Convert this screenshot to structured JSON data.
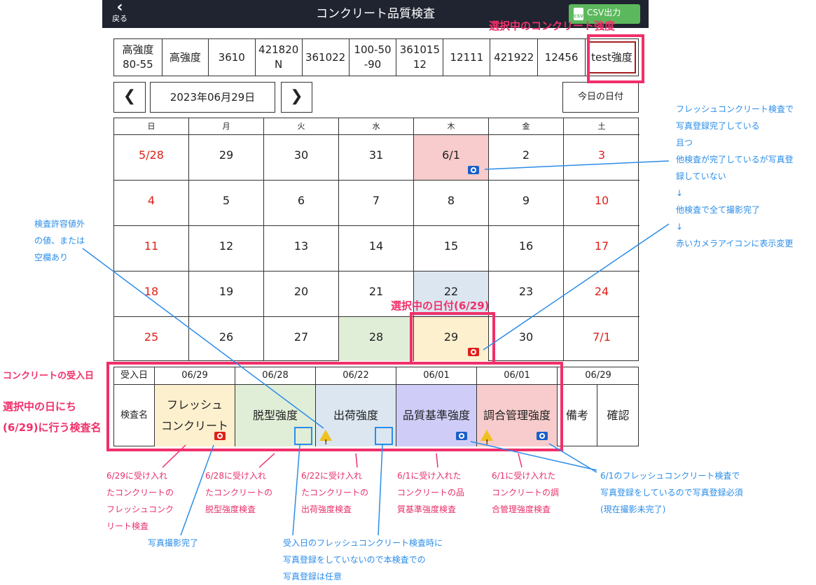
{
  "header": {
    "back_chevron": "‹",
    "back_label": "戻る",
    "title": "コンクリート品質検査",
    "csv_icon_text": "CSV",
    "csv_label": "CSV出力"
  },
  "strength_tabs": [
    {
      "label": "高強度\n80-55",
      "selected": false
    },
    {
      "label": "高強度",
      "selected": false
    },
    {
      "label": "3610",
      "selected": false
    },
    {
      "label": "421820\nN",
      "selected": false
    },
    {
      "label": "361022",
      "selected": false
    },
    {
      "label": "100-50\n-90",
      "selected": false
    },
    {
      "label": "361015\n12",
      "selected": false
    },
    {
      "label": "12111",
      "selected": false
    },
    {
      "label": "421922",
      "selected": false
    },
    {
      "label": "12456",
      "selected": false
    },
    {
      "label": "test強度",
      "selected": true
    }
  ],
  "date_nav": {
    "prev_label": "❮",
    "date": "2023年06月29日",
    "next_label": "❯",
    "today_label": "今日の日付"
  },
  "calendar": {
    "weekdays": [
      "日",
      "月",
      "火",
      "水",
      "木",
      "金",
      "土"
    ],
    "days": [
      {
        "label": "5/28",
        "red": true
      },
      {
        "label": "29"
      },
      {
        "label": "30"
      },
      {
        "label": "31"
      },
      {
        "label": "6/1",
        "bg": "#f8cccc",
        "camera": "blue-camera-icon"
      },
      {
        "label": "2"
      },
      {
        "label": "3",
        "red": true
      },
      {
        "label": "4",
        "red": true
      },
      {
        "label": "5"
      },
      {
        "label": "6"
      },
      {
        "label": "7"
      },
      {
        "label": "8"
      },
      {
        "label": "9"
      },
      {
        "label": "10",
        "red": true
      },
      {
        "label": "11",
        "red": true
      },
      {
        "label": "12"
      },
      {
        "label": "13"
      },
      {
        "label": "14"
      },
      {
        "label": "15"
      },
      {
        "label": "16"
      },
      {
        "label": "17",
        "red": true
      },
      {
        "label": "18",
        "red": true
      },
      {
        "label": "19"
      },
      {
        "label": "20"
      },
      {
        "label": "21"
      },
      {
        "label": "22",
        "bg": "#dbe6f0"
      },
      {
        "label": "23"
      },
      {
        "label": "24",
        "red": true
      },
      {
        "label": "25",
        "red": true
      },
      {
        "label": "26"
      },
      {
        "label": "27"
      },
      {
        "label": "28",
        "bg": "#e0eed8"
      },
      {
        "label": "29",
        "bg": "#fdf0cf",
        "selected": true,
        "camera": "red-camera-icon"
      },
      {
        "label": "30"
      },
      {
        "label": "7/1",
        "red": true
      }
    ]
  },
  "inspections": {
    "receipt_header": "受入日",
    "name_header": "検査名",
    "columns": [
      {
        "date": "06/29",
        "name": "フレッシュ\nコンクリート",
        "bg": "#fdf0cf",
        "icon": "red-camera-icon"
      },
      {
        "date": "06/28",
        "name": "脱型強度",
        "bg": "#e0eed8",
        "icon": "photo-placeholder-icon"
      },
      {
        "date": "06/22",
        "name": "出荷強度",
        "bg": "#dbe6f0",
        "icon": "photo-placeholder-icon",
        "warning": true
      },
      {
        "date": "06/01",
        "name": "品質基準強度",
        "bg": "#cfcdf8",
        "icon": "blue-camera-icon"
      },
      {
        "date": "06/01",
        "name": "調合管理強度",
        "bg": "#f8cccc",
        "icon": "blue-camera-icon",
        "warning": true
      }
    ],
    "extra_date": "06/29",
    "remarks_label": "備考",
    "confirm_label": "確認",
    "warning_glyph": "!"
  },
  "annotations": {
    "selected_strength": "選択中のコンクリート強度",
    "selected_date": "選択中の日付(6/29)",
    "receipt_date": "コンクリートの受入日",
    "tests_today": "選択中の日にち\n(6/29)に行う検査名",
    "tolerance": "検査許容値外\nの値、または\n空欄あり",
    "fresh_photo_flow": "フレッシュコンクリート検査で\n写真登録完了している\n且つ\n他検査が完了しているが写真登\n録していない\n↓\n他検査で全て撮影完了\n↓\n赤いカメラアイコンに表示変更",
    "note_0629": "6/29に受け入れ\nたコンクリートの\nフレッシュコンク\nリート検査",
    "note_0628": "6/28に受け入れ\nたコンクリートの\n脱型強度検査",
    "note_0622": "6/22に受け入れ\nたコンクリートの\n出荷強度検査",
    "note_0601_quality": "6/1に受け入れた\nコンクリートの品\n質基準強度検査",
    "note_0601_mix": "6/1に受け入れた\nコンクリートの調\n合管理強度検査",
    "photo_required": "6/1のフレッシュコンクリート検査で\n写真登録をしているので写真登録必須\n(現在撮影未完了)",
    "photo_done": "写真撮影完了",
    "photo_optional": "受入日のフレッシュコンクリート検査時に\n写真登録をしていないので本検査での\n写真登録は任意"
  }
}
